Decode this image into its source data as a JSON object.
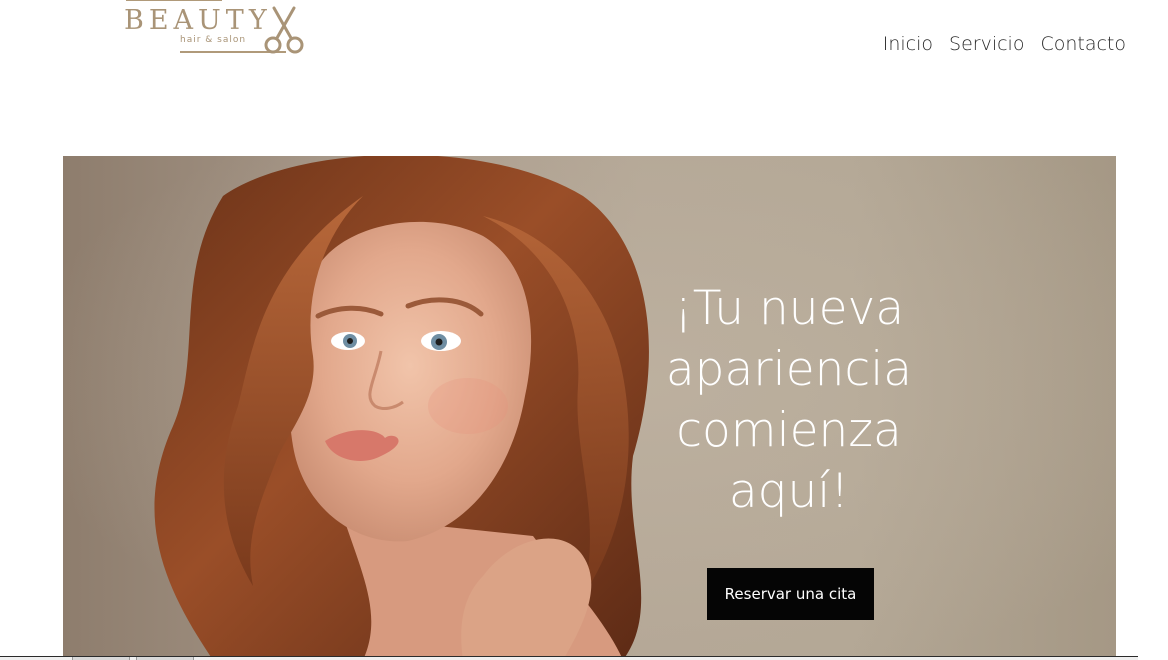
{
  "brand": {
    "name": "BEAUTY",
    "tagline": "hair & salon",
    "logo_icon": "scissors-icon",
    "color": "#a99477"
  },
  "nav": {
    "items": [
      {
        "label": "Inicio"
      },
      {
        "label": "Servicio"
      },
      {
        "label": "Contacto"
      }
    ]
  },
  "hero": {
    "heading_lines": [
      "¡Tu nueva",
      "apariencia",
      "comienza",
      "aquí!"
    ],
    "cta_label": "Reservar una cita",
    "background_color": "#b3a795",
    "cta_color": "#050505",
    "photo": "portrait-photo"
  }
}
